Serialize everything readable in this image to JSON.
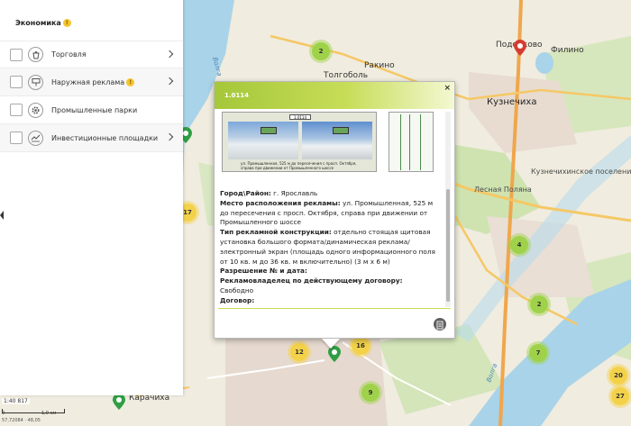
{
  "map": {
    "labels": {
      "podelkovo": "Подолково",
      "filino": "Филино",
      "rakino": "Ракино",
      "tolgobol": "Толгоболь",
      "kuznechikha": "Кузнечиха",
      "kuznechikhinskoe": "Кузнечихинское поселение",
      "lesnaya_polyana": "Лесная Поляна",
      "karachikha": "Карачиха",
      "volga": "Волга",
      "kotorosl": "Волга"
    },
    "clusters": [
      {
        "count": "2",
        "color": "green"
      },
      {
        "count": "4",
        "color": "green"
      },
      {
        "count": "2",
        "color": "green"
      },
      {
        "count": "7",
        "color": "green"
      },
      {
        "count": "9",
        "color": "green"
      },
      {
        "count": "12",
        "color": "yellow"
      },
      {
        "count": "16",
        "color": "yellow"
      },
      {
        "count": "17",
        "color": "yellow"
      },
      {
        "count": "20",
        "color": "yellow"
      },
      {
        "count": "27",
        "color": "yellow"
      }
    ],
    "colors": {
      "land": "#f0ecdf",
      "water": "#a9d3e8",
      "green_area": "#cfe3b0",
      "road": "#f5c866",
      "road_major": "#f0a64c"
    }
  },
  "panel": {
    "title": "Экономика",
    "title_badge": "!",
    "items": [
      {
        "label": "Торговля",
        "icon": "shopping-bag-icon"
      },
      {
        "label": "Наружная реклама",
        "icon": "billboard-icon",
        "badge": "!"
      },
      {
        "label": "Промышленные парки",
        "icon": "gear-icon"
      },
      {
        "label": "Инвестиционные площадки",
        "icon": "growth-chart-icon"
      }
    ]
  },
  "scale": {
    "zoom": "1:40 817",
    "label_left": "0",
    "label_right": "1,0 км",
    "coords": "57,72084 · 48,05"
  },
  "popup": {
    "title": "1.0114",
    "close": "×",
    "photo_tag": "1.0114",
    "photo_caption": "ул. Промышленная, 525 м до пересечения с просп. Октября, справа при движении от Промышленного шоссе",
    "fields": [
      {
        "label": "Город\\Район:",
        "value": " г. Ярославль"
      },
      {
        "label": "Место расположения рекламы:",
        "value": " ул. Промышленная, 525 м до пересечения с просп. Октября, справа при движении от Промышленного шоссе"
      },
      {
        "label": "Тип рекламной конструкции:",
        "value": " отдельно стоящая щитовая установка большого формата/динамическая реклама/электронный экран (площадь одного информационного поля от 10 кв. м до 36 кв. м включительно) (3 м х 6 м)"
      },
      {
        "label": "Разрешение № и дата:",
        "value": ""
      },
      {
        "label": "Рекламовладелец по действующему договору:",
        "value": " Свободно"
      },
      {
        "label": "Договор:",
        "value": ""
      }
    ]
  }
}
